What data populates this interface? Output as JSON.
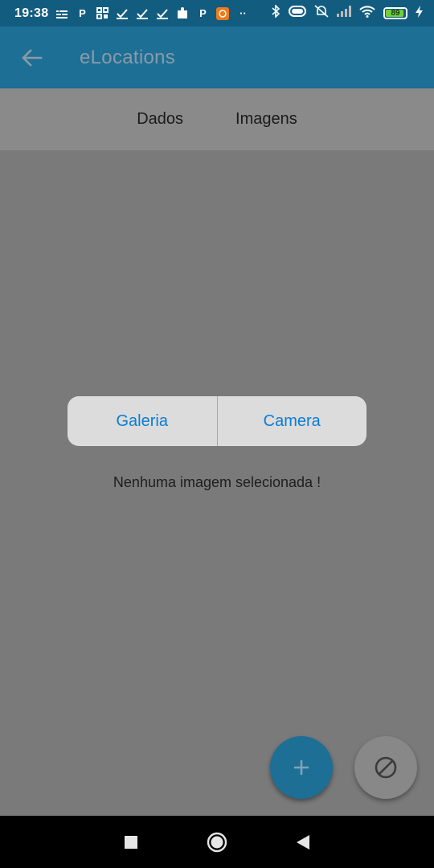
{
  "status_bar": {
    "time": "19:38",
    "battery_percent": "89",
    "notification_icons": [
      "sliders-icon",
      "p-icon",
      "qr-icon",
      "check-icon",
      "check-icon",
      "check-icon",
      "puzzle-icon",
      "p-icon",
      "app-icon",
      "dots-icon"
    ],
    "system_icons": [
      "bluetooth-icon",
      "toggle-icon",
      "mute-icon",
      "signal-icon",
      "wifi-icon",
      "battery-icon",
      "charging-icon"
    ]
  },
  "app_bar": {
    "title": "eLocations",
    "back_icon": "arrow-left-icon"
  },
  "tabs": [
    {
      "label": "Dados"
    },
    {
      "label": "Imagens"
    }
  ],
  "image_picker": {
    "gallery_label": "Galeria",
    "camera_label": "Camera",
    "empty_message": "Nenhuma imagem selecionada !"
  },
  "fabs": {
    "add_icon": "plus-icon",
    "cancel_icon": "block-icon"
  },
  "colors": {
    "primary": "#1d6f96",
    "status_bar": "#125c80",
    "accent_text": "#0a7cd6",
    "scrim_background": "#7a7a7a",
    "battery_green": "#6dd13a"
  }
}
